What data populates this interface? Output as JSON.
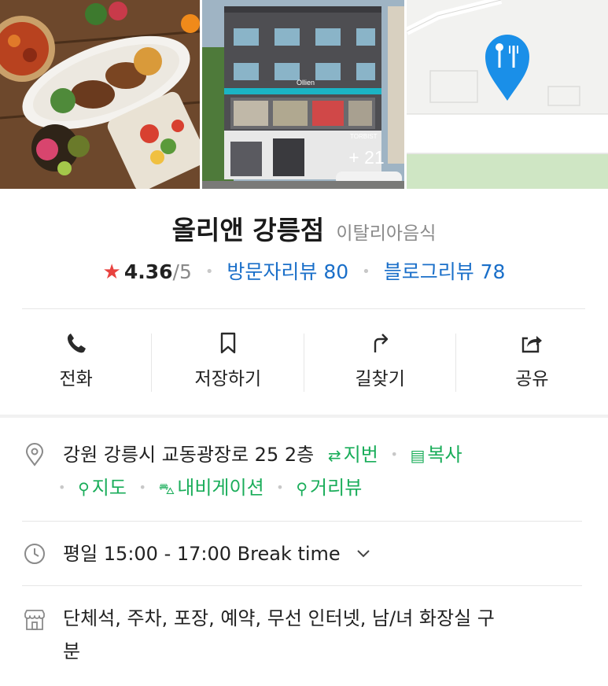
{
  "photos": {
    "more_count": "+ 21",
    "storefront_signs": [
      "Ollien",
      "TORBIST"
    ]
  },
  "place": {
    "name": "올리앤 강릉점",
    "category": "이탈리아음식",
    "rating": "4.36",
    "rating_max": "/5",
    "visitor_reviews": "방문자리뷰 80",
    "blog_reviews": "블로그리뷰 78"
  },
  "actions": [
    {
      "label": "전화",
      "icon": "phone-icon"
    },
    {
      "label": "저장하기",
      "icon": "bookmark-icon"
    },
    {
      "label": "길찾기",
      "icon": "directions-icon"
    },
    {
      "label": "공유",
      "icon": "share-icon"
    }
  ],
  "address": {
    "text": "강원 강릉시 교동광장로 25 2층",
    "jibun": "지번",
    "copy": "복사",
    "map": "지도",
    "navigation": "내비게이션",
    "streetview": "거리뷰"
  },
  "hours": {
    "text": "평일 15:00 - 17:00 Break time"
  },
  "amenities": {
    "line1": "단체석, 주차, 포장, 예약, 무선 인터넷, 남/녀 화장실 구",
    "line2": "분"
  },
  "colors": {
    "star": "#e8423f",
    "link_blue": "#1a6fc9",
    "accent_green": "#1aad5a",
    "map_pin": "#1a8fe8"
  }
}
